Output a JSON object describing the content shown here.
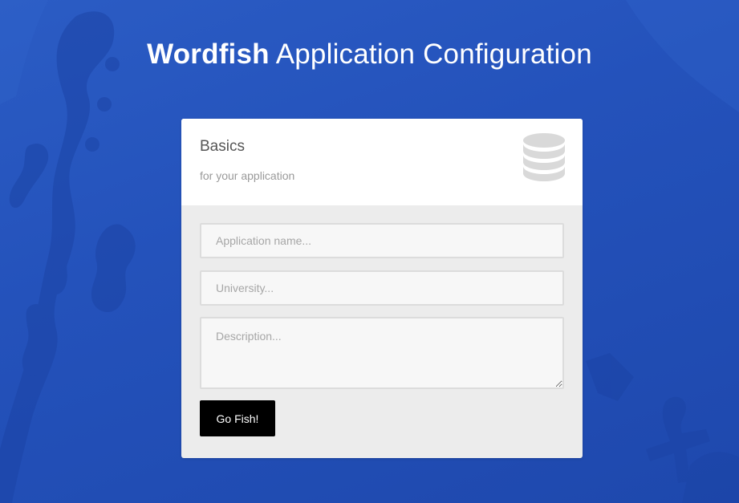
{
  "header": {
    "brand": "Wordfish",
    "title_rest": " Application Configuration"
  },
  "card": {
    "title": "Basics",
    "subtitle": "for your application",
    "icon": "database-icon"
  },
  "form": {
    "app_name_placeholder": "Application name...",
    "university_placeholder": "University...",
    "description_placeholder": "Description...",
    "submit_label": "Go Fish!"
  },
  "colors": {
    "background": "#2452bb",
    "button": "#000000",
    "icon": "#d9d9d9"
  }
}
